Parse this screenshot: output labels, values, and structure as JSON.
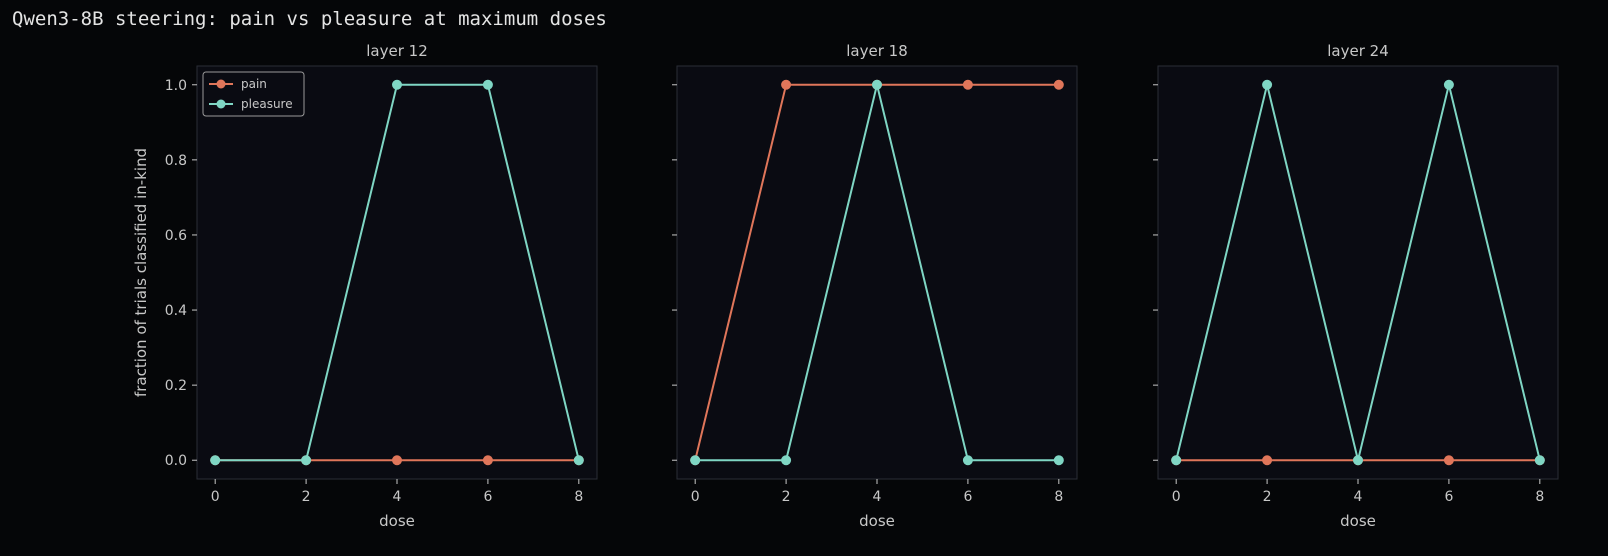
{
  "figure": {
    "title": "Qwen3-8B steering: pain vs pleasure at maximum doses",
    "colors": {
      "background": "#050608",
      "axes_background": "#0a0b12",
      "spine": "#2a2d36",
      "text": "#c8c8c8",
      "pain": "#e0765a",
      "pleasure": "#7fd6c4"
    }
  },
  "chart_data": [
    {
      "type": "line",
      "title": "layer 12",
      "xlabel": "dose",
      "ylabel": "fraction of trials classified in-kind",
      "xlim": [
        -0.4,
        8.4
      ],
      "ylim": [
        -0.05,
        1.05
      ],
      "xticks": [
        0,
        2,
        4,
        6,
        8
      ],
      "yticks": [
        0.0,
        0.2,
        0.4,
        0.6,
        0.8,
        1.0
      ],
      "xtick_labels": [
        "0",
        "2",
        "4",
        "6",
        "8"
      ],
      "ytick_labels": [
        "0.0",
        "0.2",
        "0.4",
        "0.6",
        "0.8",
        "1.0"
      ],
      "legend": {
        "placement": "top-left",
        "entries": [
          "pain",
          "pleasure"
        ]
      },
      "x": [
        0,
        2,
        4,
        6,
        8
      ],
      "series": [
        {
          "name": "pain",
          "color": "#e0765a",
          "values": [
            0,
            0,
            0,
            0,
            0
          ]
        },
        {
          "name": "pleasure",
          "color": "#7fd6c4",
          "values": [
            0,
            0,
            1,
            1,
            0
          ]
        }
      ]
    },
    {
      "type": "line",
      "title": "layer 18",
      "xlabel": "dose",
      "ylabel": "",
      "xlim": [
        -0.4,
        8.4
      ],
      "ylim": [
        -0.05,
        1.05
      ],
      "xticks": [
        0,
        2,
        4,
        6,
        8
      ],
      "yticks": [
        0.0,
        0.2,
        0.4,
        0.6,
        0.8,
        1.0
      ],
      "xtick_labels": [
        "0",
        "2",
        "4",
        "6",
        "8"
      ],
      "ytick_labels": [],
      "x": [
        0,
        2,
        4,
        6,
        8
      ],
      "series": [
        {
          "name": "pain",
          "color": "#e0765a",
          "values": [
            0,
            1,
            1,
            1,
            1
          ]
        },
        {
          "name": "pleasure",
          "color": "#7fd6c4",
          "values": [
            0,
            0,
            1,
            0,
            0
          ]
        }
      ]
    },
    {
      "type": "line",
      "title": "layer 24",
      "xlabel": "dose",
      "ylabel": "",
      "xlim": [
        -0.4,
        8.4
      ],
      "ylim": [
        -0.05,
        1.05
      ],
      "xticks": [
        0,
        2,
        4,
        6,
        8
      ],
      "yticks": [
        0.0,
        0.2,
        0.4,
        0.6,
        0.8,
        1.0
      ],
      "xtick_labels": [
        "0",
        "2",
        "4",
        "6",
        "8"
      ],
      "ytick_labels": [],
      "x": [
        0,
        2,
        4,
        6,
        8
      ],
      "series": [
        {
          "name": "pain",
          "color": "#e0765a",
          "values": [
            0,
            0,
            0,
            0,
            0
          ]
        },
        {
          "name": "pleasure",
          "color": "#7fd6c4",
          "values": [
            0,
            1,
            0,
            1,
            0
          ]
        }
      ]
    }
  ]
}
